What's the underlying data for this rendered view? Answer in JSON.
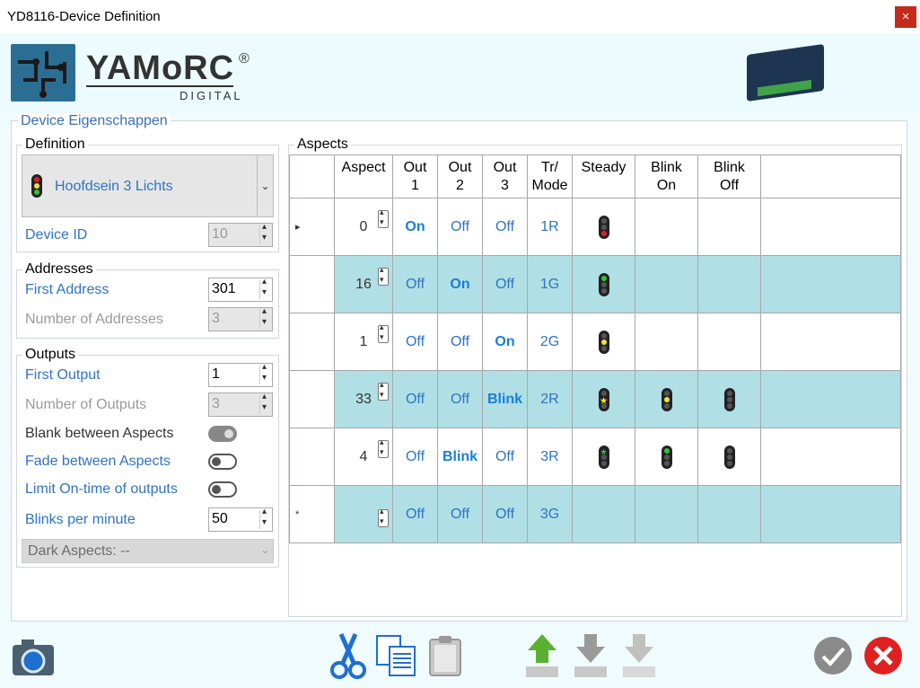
{
  "window": {
    "title": "YD8116-Device  Definition",
    "close_icon": "×"
  },
  "header": {
    "brand": "YAMoRC",
    "registered": "®",
    "brand_sub": "DIGITAL"
  },
  "device_props": {
    "title": "Device Eigenschappen"
  },
  "definition": {
    "title": "Definition",
    "selected": "Hoofdsein 3 Lichts",
    "device_id_label": "Device ID",
    "device_id_value": "10"
  },
  "addresses": {
    "title": "Addresses",
    "first_address_label": "First Address",
    "first_address_value": "301",
    "num_addresses_label": "Number of Addresses",
    "num_addresses_value": "3"
  },
  "outputs": {
    "title": "Outputs",
    "first_output_label": "First Output",
    "first_output_value": "1",
    "num_outputs_label": "Number of Outputs",
    "num_outputs_value": "3",
    "blank_label": "Blank between Aspects",
    "blank_on": true,
    "fade_label": "Fade between Aspects",
    "fade_on": false,
    "limit_label": "Limit On-time of outputs",
    "limit_on": false,
    "blinks_label": "Blinks per minute",
    "blinks_value": "50",
    "dark_aspects": "Dark Aspects: --"
  },
  "aspects": {
    "title": "Aspects",
    "columns": [
      "",
      "Aspect",
      "Out\n1",
      "Out\n2",
      "Out\n3",
      "Tr/\nMode",
      "Steady",
      "Blink\nOn",
      "Blink\nOff",
      ""
    ],
    "col_labels": {
      "aspect": "Aspect",
      "out1_a": "Out",
      "out1_b": "1",
      "out2_a": "Out",
      "out2_b": "2",
      "out3_a": "Out",
      "out3_b": "3",
      "tr_a": "Tr/",
      "tr_b": "Mode",
      "steady": "Steady",
      "bon_a": "Blink",
      "bon_b": "On",
      "boff_a": "Blink",
      "boff_b": "Off"
    },
    "rows": [
      {
        "marker": "▸",
        "aspect": "0",
        "out1": "On",
        "out2": "Off",
        "out3": "Off",
        "mode": "1R",
        "steady": "red",
        "blink_on": "",
        "blink_off": ""
      },
      {
        "marker": "",
        "aspect": "16",
        "out1": "Off",
        "out2": "On",
        "out3": "Off",
        "mode": "1G",
        "steady": "green",
        "blink_on": "",
        "blink_off": ""
      },
      {
        "marker": "",
        "aspect": "1",
        "out1": "Off",
        "out2": "Off",
        "out3": "On",
        "mode": "2G",
        "steady": "yellow",
        "blink_on": "",
        "blink_off": ""
      },
      {
        "marker": "",
        "aspect": "33",
        "out1": "Off",
        "out2": "Off",
        "out3": "Blink",
        "mode": "2R",
        "steady": "yellow-star",
        "blink_on": "yellow",
        "blink_off": "dark"
      },
      {
        "marker": "",
        "aspect": "4",
        "out1": "Off",
        "out2": "Blink",
        "out3": "Off",
        "mode": "3R",
        "steady": "green-star",
        "blink_on": "green",
        "blink_off": "dark"
      },
      {
        "marker": "*",
        "aspect": "",
        "out1": "Off",
        "out2": "Off",
        "out3": "Off",
        "mode": "3G",
        "steady": "",
        "blink_on": "",
        "blink_off": ""
      }
    ]
  },
  "toolbar": {
    "icons": [
      "camera-icon",
      "cut-icon",
      "copy-icon",
      "paste-icon",
      "move-up-icon",
      "move-down-icon",
      "move-down-disabled-icon",
      "ok-icon",
      "cancel-icon"
    ]
  },
  "colors": {
    "accent": "#2f73c4",
    "row_alt": "#b0dfe5",
    "close": "#c42b1c",
    "ok": "#8a8a8a",
    "cancel": "#e02020",
    "up": "#5ab031"
  }
}
